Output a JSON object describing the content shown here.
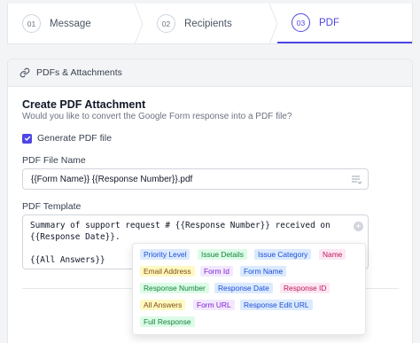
{
  "stepper": {
    "steps": [
      {
        "number": "01",
        "label": "Message"
      },
      {
        "number": "02",
        "label": "Recipients"
      },
      {
        "number": "03",
        "label": "PDF"
      }
    ],
    "active": "PDF"
  },
  "card": {
    "header": "PDFs & Attachments",
    "title": "Create PDF Attachment",
    "subtitle": "Would you like to convert the Google Form response into a PDF file?",
    "generate_pdf": {
      "label": "Generate PDF file",
      "checked": true
    },
    "file_name": {
      "label": "PDF File Name",
      "value": "{{Form Name}} {{Response Number}}.pdf"
    },
    "template": {
      "label": "PDF Template",
      "lines": [
        "Summary of support request # {{Response Number}} received on",
        "{{Response Date}}.",
        "",
        "{{All Answers}}"
      ]
    }
  },
  "placeholders": [
    {
      "label": "Priority Level",
      "color": "blue"
    },
    {
      "label": "Issue Details",
      "color": "green"
    },
    {
      "label": "Issue Category",
      "color": "blue"
    },
    {
      "label": "Name",
      "color": "pink"
    },
    {
      "label": "Email Address",
      "color": "yellow"
    },
    {
      "label": "Form Id",
      "color": "purple"
    },
    {
      "label": "Form Name",
      "color": "blue"
    },
    {
      "label": "Response Number",
      "color": "green"
    },
    {
      "label": "Response Date",
      "color": "blue"
    },
    {
      "label": "Response ID",
      "color": "pink"
    },
    {
      "label": "All Answers",
      "color": "yellow"
    },
    {
      "label": "Form URL",
      "color": "purple"
    },
    {
      "label": "Response Edit URL",
      "color": "blue"
    },
    {
      "label": "Full Response",
      "color": "green"
    }
  ],
  "colors": {
    "accent": "#4f46e5"
  }
}
